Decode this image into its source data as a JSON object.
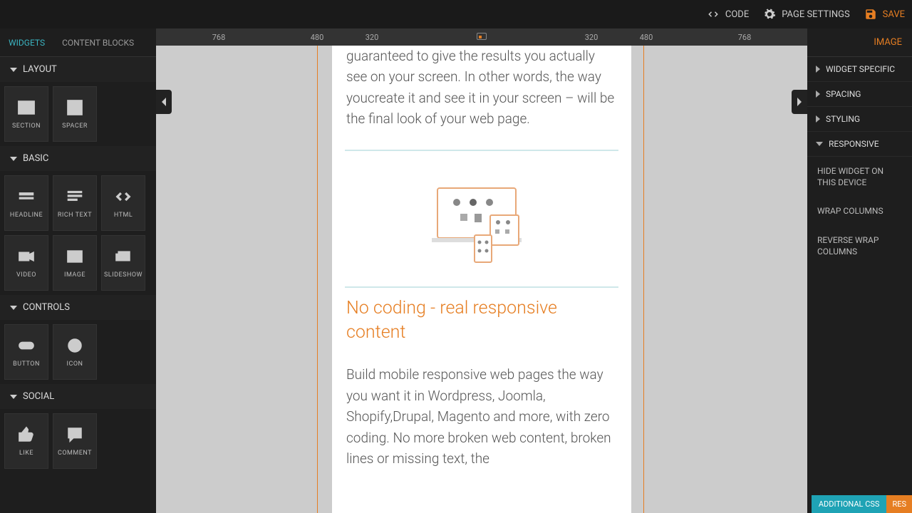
{
  "topbar": {
    "code": "CODE",
    "page_settings": "PAGE SETTINGS",
    "save": "SAVE"
  },
  "tabs": {
    "widgets": "WIDGETS",
    "content_blocks": "CONTENT BLOCKS"
  },
  "groups": {
    "layout": {
      "title": "LAYOUT",
      "items": [
        "SECTION",
        "SPACER"
      ]
    },
    "basic": {
      "title": "BASIC",
      "items": [
        "HEADLINE",
        "RICH TEXT",
        "HTML",
        "VIDEO",
        "IMAGE",
        "SLIDESHOW"
      ]
    },
    "controls": {
      "title": "CONTROLS",
      "items": [
        "BUTTON",
        "ICON"
      ]
    },
    "social": {
      "title": "SOCIAL",
      "items": [
        "LIKE",
        "COMMENT"
      ]
    }
  },
  "ruler": [
    "768",
    "480",
    "320",
    "320",
    "480",
    "768"
  ],
  "content": {
    "para1": "guaranteed to give the results you actually see on your screen. In other words, the way youcreate it and see it in your screen – will be the final look of your web page.",
    "heading": "No coding - real responsive content",
    "para2": "Build mobile responsive web pages the way you want it in Wordpress, Joomla, Shopify,Drupal, Magento and more, with zero coding. No more broken web content, broken lines or missing text, the"
  },
  "right": {
    "tab": "IMAGE",
    "sections": [
      "WIDGET SPECIFIC",
      "SPACING",
      "STYLING",
      "RESPONSIVE"
    ],
    "responsive_items": [
      "HIDE WIDGET ON THIS DEVICE",
      "WRAP COLUMNS",
      "REVERSE WRAP COLUMNS"
    ]
  },
  "bottom": {
    "css": "ADDITIONAL CSS",
    "res": "RES"
  }
}
